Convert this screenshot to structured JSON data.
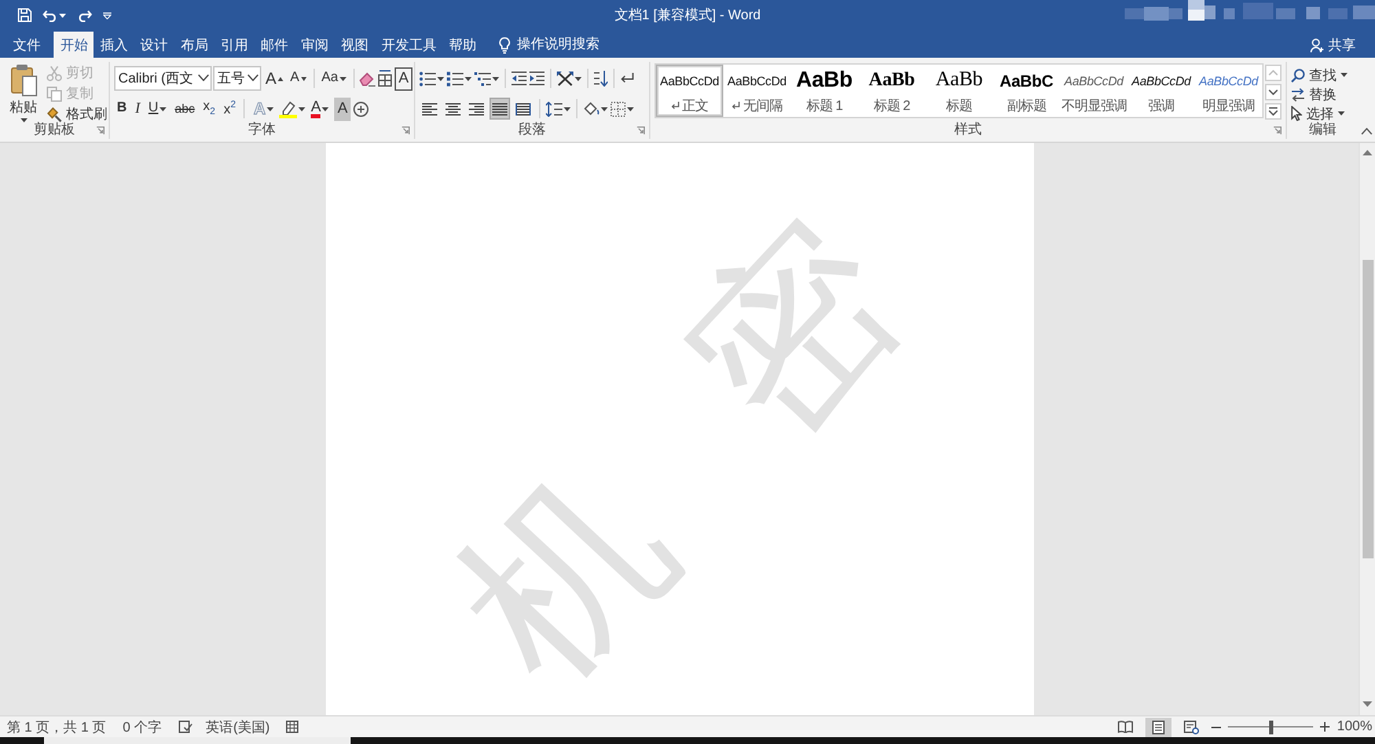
{
  "title_bar": {
    "title": "文档1 [兼容模式] - Word"
  },
  "tabs": [
    {
      "label": "文件",
      "selected": false
    },
    {
      "label": "开始",
      "selected": true
    },
    {
      "label": "插入",
      "selected": false
    },
    {
      "label": "设计",
      "selected": false
    },
    {
      "label": "布局",
      "selected": false
    },
    {
      "label": "引用",
      "selected": false
    },
    {
      "label": "邮件",
      "selected": false
    },
    {
      "label": "审阅",
      "selected": false
    },
    {
      "label": "视图",
      "selected": false
    },
    {
      "label": "开发工具",
      "selected": false
    },
    {
      "label": "帮助",
      "selected": false
    }
  ],
  "tell_me": {
    "placeholder": "操作说明搜索"
  },
  "share": {
    "label": "共享"
  },
  "ribbon": {
    "clipboard": {
      "label": "剪贴板",
      "paste": "粘贴",
      "actions": [
        {
          "kind": "cut",
          "label": "剪切",
          "disabled": true
        },
        {
          "kind": "copy",
          "label": "复制",
          "disabled": true
        },
        {
          "kind": "painter",
          "label": "格式刷",
          "disabled": false
        }
      ]
    },
    "font": {
      "label": "字体",
      "font_name": "Calibri (西文",
      "font_size": "五号",
      "row_1": [
        {
          "kind": "grow",
          "label": "A"
        },
        {
          "kind": "shrink",
          "label": "A"
        },
        {
          "kind": "case",
          "label": "Aa"
        },
        {
          "kind": "clear"
        },
        {
          "kind": "phonetic"
        },
        {
          "kind": "border",
          "label": "A"
        }
      ],
      "row_2": [
        {
          "kind": "bold",
          "label": "B"
        },
        {
          "kind": "italic",
          "label": "I"
        },
        {
          "kind": "underline",
          "label": "U"
        },
        {
          "kind": "strike",
          "label": "abc"
        },
        {
          "kind": "sub",
          "label": "x$_{2}$"
        },
        {
          "kind": "sup",
          "label": "x$^{2}$"
        },
        {
          "kind": "effects",
          "label": "A"
        },
        {
          "kind": "highlight"
        },
        {
          "kind": "color",
          "label": "A"
        },
        {
          "kind": "shading",
          "label": "A"
        },
        {
          "kind": "enclose"
        }
      ]
    },
    "paragraph": {
      "label": "段落",
      "alignment": [
        {
          "kind": "left",
          "selected": false
        },
        {
          "kind": "center",
          "selected": false
        },
        {
          "kind": "right",
          "selected": false
        },
        {
          "kind": "justify",
          "selected": true
        },
        {
          "kind": "distributed",
          "selected": false
        }
      ]
    },
    "styles": {
      "label": "样式",
      "items": [
        {
          "kind": "normal",
          "preview": "AaBbCcDd",
          "name": "正文",
          "selected": true,
          "paragraph_mark": true
        },
        {
          "kind": "nospacing",
          "preview": "AaBbCcDd",
          "name": "无间隔",
          "selected": false,
          "paragraph_mark": true
        },
        {
          "kind": "heading1",
          "preview": "AaBb",
          "name": "标题 1",
          "selected": false,
          "paragraph_mark": false
        },
        {
          "kind": "heading2",
          "preview": "AaBb",
          "name": "标题 2",
          "selected": false,
          "paragraph_mark": false
        },
        {
          "kind": "title",
          "preview": "AaBb",
          "name": "标题",
          "selected": false,
          "paragraph_mark": false
        },
        {
          "kind": "subtitle",
          "preview": "AaBbC",
          "name": "副标题",
          "selected": false,
          "paragraph_mark": false
        },
        {
          "kind": "subtle",
          "preview": "AaBbCcDd",
          "name": "不明显强调",
          "selected": false,
          "paragraph_mark": false
        },
        {
          "kind": "emphasis",
          "preview": "AaBbCcDd",
          "name": "强调",
          "selected": false,
          "paragraph_mark": false
        },
        {
          "kind": "intense",
          "preview": "AaBbCcDd",
          "name": "明显强调",
          "selected": false,
          "paragraph_mark": false
        }
      ]
    },
    "editing": {
      "label": "编辑",
      "items": [
        {
          "kind": "find",
          "label": "查找"
        },
        {
          "kind": "replace",
          "label": "替换"
        },
        {
          "kind": "select",
          "label": "选择"
        }
      ]
    }
  },
  "document": {
    "watermark": "机密"
  },
  "status_bar": {
    "page": "第 1 页，共 1 页",
    "words": "0 个字",
    "language": "英语(美国)",
    "views": [
      {
        "kind": "read",
        "selected": false
      },
      {
        "kind": "print",
        "selected": true
      },
      {
        "kind": "web",
        "selected": false
      }
    ],
    "zoom": {
      "level": 0.5,
      "reading": "100%"
    }
  }
}
